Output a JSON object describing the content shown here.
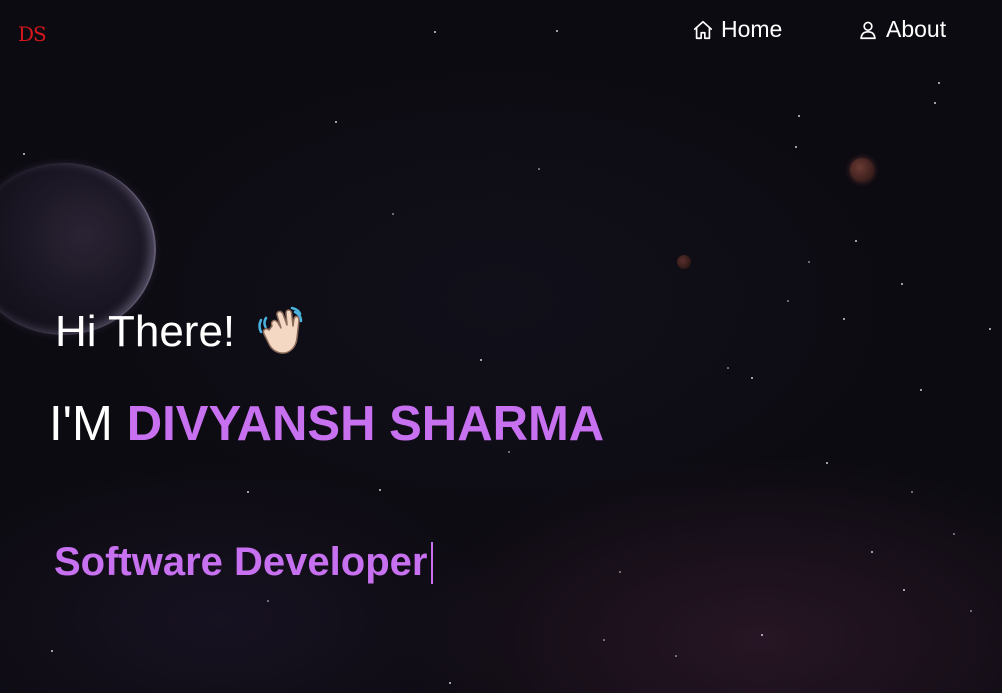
{
  "header": {
    "logo_text": "DS",
    "nav": [
      {
        "label": "Home",
        "icon": "home-icon"
      },
      {
        "label": "About",
        "icon": "user-icon"
      }
    ]
  },
  "hero": {
    "greeting": "Hi There!",
    "greeting_emoji": "waving-hand-icon",
    "intro_prefix": "I'M",
    "name": "DIVYANSH SHARMA",
    "typed_role": "Software Developer"
  },
  "colors": {
    "background": "#0d0b12",
    "accent": "#c770f0",
    "logo": "#d5171d",
    "text": "#ffffff"
  }
}
